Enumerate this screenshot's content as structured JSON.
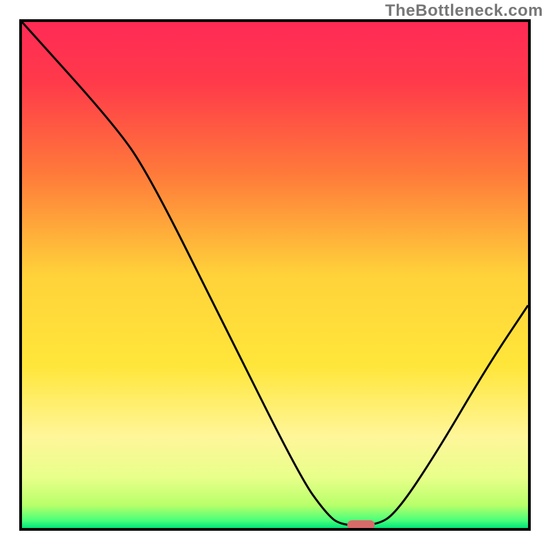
{
  "watermark": "TheBottleneck.com",
  "chart_data": {
    "type": "line",
    "title": "",
    "xlabel": "",
    "ylabel": "",
    "xlim": [
      0,
      100
    ],
    "ylim": [
      0,
      100
    ],
    "gradient_stops": [
      {
        "offset": 0.0,
        "color": "#ff2a55"
      },
      {
        "offset": 0.12,
        "color": "#ff3a4a"
      },
      {
        "offset": 0.3,
        "color": "#ff7a3a"
      },
      {
        "offset": 0.5,
        "color": "#ffd23a"
      },
      {
        "offset": 0.68,
        "color": "#ffe63a"
      },
      {
        "offset": 0.82,
        "color": "#fff69a"
      },
      {
        "offset": 0.9,
        "color": "#e8ff8a"
      },
      {
        "offset": 0.955,
        "color": "#b8ff6a"
      },
      {
        "offset": 0.985,
        "color": "#4aff7a"
      },
      {
        "offset": 1.0,
        "color": "#00e57a"
      }
    ],
    "series": [
      {
        "name": "curve",
        "points": [
          {
            "x": 0,
            "y": 100
          },
          {
            "x": 18,
            "y": 80
          },
          {
            "x": 25,
            "y": 70
          },
          {
            "x": 40,
            "y": 40
          },
          {
            "x": 55,
            "y": 10
          },
          {
            "x": 60,
            "y": 3
          },
          {
            "x": 63,
            "y": 0.5
          },
          {
            "x": 70,
            "y": 0.5
          },
          {
            "x": 74,
            "y": 3
          },
          {
            "x": 82,
            "y": 15
          },
          {
            "x": 92,
            "y": 32
          },
          {
            "x": 100,
            "y": 44
          }
        ]
      }
    ],
    "marker": {
      "x": 67,
      "y": 0.6,
      "color": "#d96a6a"
    }
  }
}
